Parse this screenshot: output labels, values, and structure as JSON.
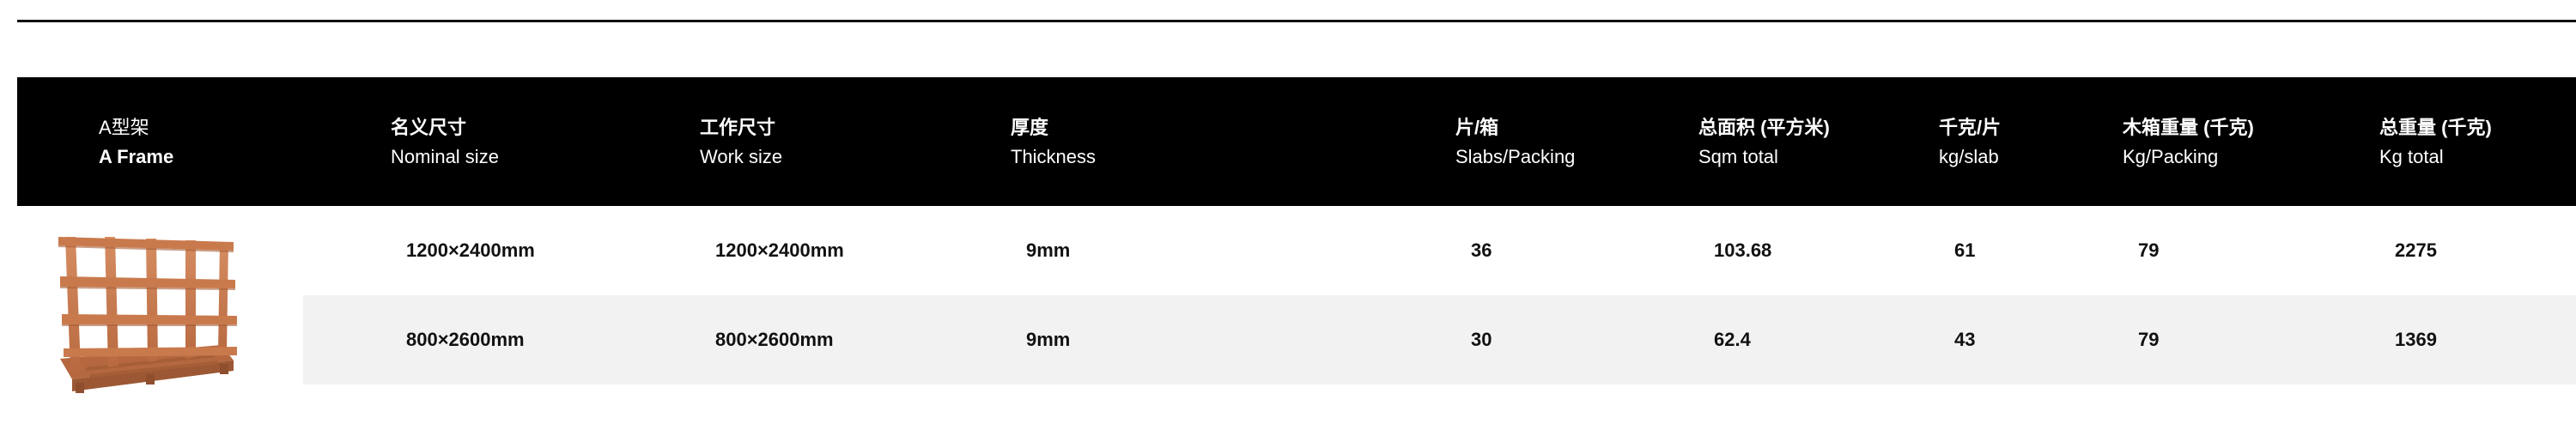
{
  "table": {
    "headers": [
      {
        "zh": "A型架",
        "en": "A Frame"
      },
      {
        "zh": "名义尺寸",
        "en": "Nominal size"
      },
      {
        "zh": "工作尺寸",
        "en": "Work size"
      },
      {
        "zh": "厚度",
        "en": "Thickness"
      },
      {
        "zh": "片/箱",
        "en": "Slabs/Packing"
      },
      {
        "zh": "总面积 (平方米)",
        "en": "Sqm total"
      },
      {
        "zh": "千克/片",
        "en": "kg/slab"
      },
      {
        "zh": "木箱重量 (千克)",
        "en": "Kg/Packing"
      },
      {
        "zh": "总重量 (千克)",
        "en": "Kg total"
      }
    ],
    "rows": [
      [
        "1200×2400mm",
        "1200×2400mm",
        "9mm",
        "36",
        "103.68",
        "61",
        "79",
        "2275"
      ],
      [
        "800×2600mm",
        "800×2600mm",
        "9mm",
        "30",
        "62.4",
        "43",
        "79",
        "1369"
      ]
    ]
  },
  "image": {
    "icon": "wooden-a-frame-rack",
    "wood_color": "#c77a52"
  },
  "colors": {
    "header_bg": "#000000",
    "header_text": "#ffffff",
    "row_alt_bg": "#f2f2f2",
    "text": "#111111"
  }
}
